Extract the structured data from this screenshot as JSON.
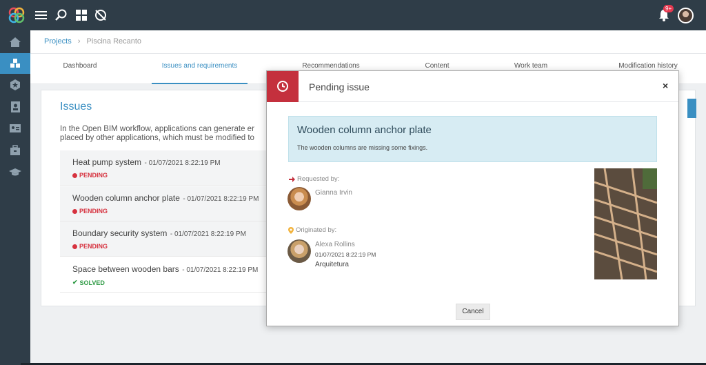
{
  "topbar": {
    "notification_count": "9+",
    "colors": {
      "bar": "#2f3d48",
      "accent": "#3a8fc2",
      "badge": "#e53950"
    }
  },
  "sidebar": {
    "items": [
      {
        "icon": "home-icon"
      },
      {
        "icon": "cubes-icon",
        "active": true
      },
      {
        "icon": "star-badge-icon"
      },
      {
        "icon": "contacts-book-icon"
      },
      {
        "icon": "id-card-icon"
      },
      {
        "icon": "briefcase-icon"
      },
      {
        "icon": "graduation-cap-icon"
      }
    ]
  },
  "breadcrumb": {
    "root": "Projects",
    "current": "Piscina Recanto"
  },
  "tabs": [
    {
      "label": "Dashboard"
    },
    {
      "label": "Issues and requirements",
      "active": true
    },
    {
      "label": "Recommendations"
    },
    {
      "label": "Content"
    },
    {
      "label": "Work team"
    },
    {
      "label": "Modification history"
    }
  ],
  "issues_panel": {
    "title": "Issues",
    "description_line1": "In the Open BIM workflow, applications can generate er",
    "description_line2": "placed by other applications, which must be modified to",
    "items": [
      {
        "title": "Heat pump system",
        "date": "01/07/2021 8:22:19 PM",
        "status": "PENDING"
      },
      {
        "title": "Wooden column anchor plate",
        "date": "01/07/2021 8:22:19 PM",
        "status": "PENDING"
      },
      {
        "title": "Boundary security system",
        "date": "01/07/2021 8:22:19 PM",
        "status": "PENDING"
      },
      {
        "title": "Space between wooden bars",
        "date": "01/07/2021 8:22:19 PM",
        "status": "SOLVED"
      }
    ]
  },
  "modal": {
    "title": "Pending issue",
    "close": "×",
    "issue_title": "Wooden column anchor plate",
    "issue_description": "The wooden columns are missing some fixings.",
    "requested_label": "Requested by:",
    "requested_name": "Gianna Irvin",
    "originated_label": "Originated by:",
    "originated_name": "Alexa Rollins",
    "originated_date": "01/07/2021 8:22:19 PM",
    "originated_role": "Arquitetura",
    "cancel_label": "Cancel"
  }
}
